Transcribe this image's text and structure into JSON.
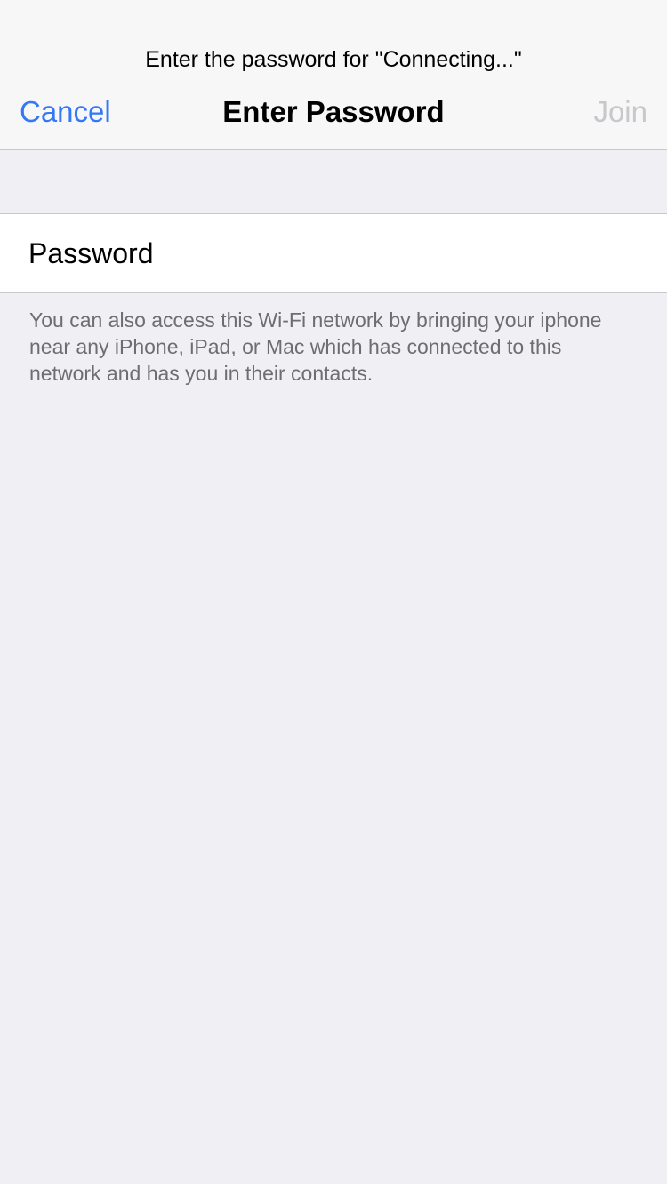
{
  "header": {
    "prompt": "Enter the password for \"Connecting...\"",
    "title": "Enter Password",
    "cancel_label": "Cancel",
    "join_label": "Join"
  },
  "form": {
    "password_placeholder": "Password",
    "password_value": ""
  },
  "footer": {
    "note": "You can also access this Wi-Fi network by bringing your iphone near any iPhone, iPad, or Mac which has connected to this network and has you in their contacts."
  },
  "colors": {
    "accent": "#3478f6",
    "disabled": "#c7c7cc",
    "background": "#efeff4",
    "nav_background": "#f7f7f7",
    "footer_text": "#6d6d72"
  }
}
